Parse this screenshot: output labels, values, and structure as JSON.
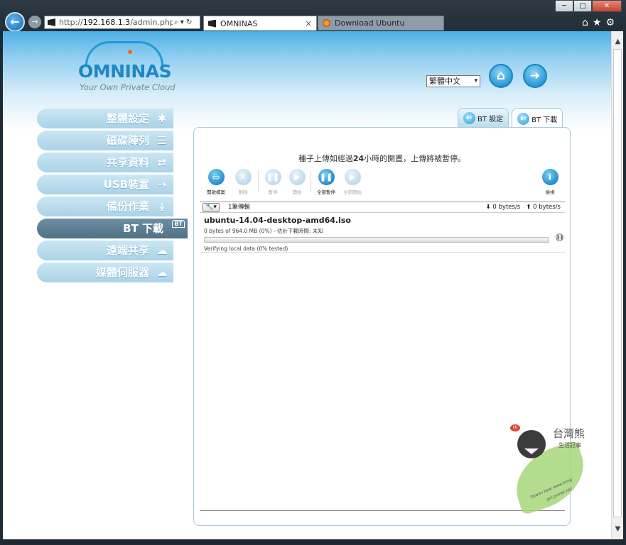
{
  "browser": {
    "window_controls": {
      "minimize": "─",
      "maximize": "□",
      "close": "✕"
    },
    "back_glyph": "←",
    "forward_glyph": "→",
    "address": {
      "prefix": "http://",
      "host": "192.168.1.3",
      "path": "/admin.php?mer",
      "tools": "⌕ ▾ ↻"
    },
    "tabs": [
      {
        "label": "OMNINAS",
        "close": "×"
      },
      {
        "label": "Download Ubuntu"
      }
    ],
    "right_icons": "⌂★⚙"
  },
  "header": {
    "brand": "OMNINAS",
    "tagline": "Your Own Private Cloud",
    "language": "繁體中文",
    "caret": "▾",
    "home_icon": "⌂",
    "logout_icon": "➜"
  },
  "sidebar": {
    "items": [
      {
        "label": "整體設定",
        "icon": "✱"
      },
      {
        "label": "磁碟陣列",
        "icon": "☰"
      },
      {
        "label": "共享資料",
        "icon": "⇄"
      },
      {
        "label": "USB裝置",
        "icon": "⇢"
      },
      {
        "label": "備份作業",
        "icon": "⤓"
      },
      {
        "label": "BT 下載",
        "icon": "BT"
      },
      {
        "label": "遠端共享",
        "icon": "☁"
      },
      {
        "label": "媒體伺服器",
        "icon": "☁"
      }
    ]
  },
  "panel_tabs": [
    {
      "label": "BT 設定",
      "badge": "BT"
    },
    {
      "label": "BT 下載",
      "badge": "BT"
    }
  ],
  "notice": {
    "before": "種子上傳如經過",
    "highlight": "24",
    "after": "小時的開置，上傳將被暫停。"
  },
  "toolbar": [
    {
      "label": "開啟檔案",
      "icon": "▭"
    },
    {
      "label": "刪除",
      "icon": "✕"
    },
    {
      "label": "暫停",
      "icon": "❚❚"
    },
    {
      "label": "開始",
      "icon": "▶"
    },
    {
      "label": "全部暫停",
      "icon": "❚❚"
    },
    {
      "label": "全部開始",
      "icon": "▶"
    },
    {
      "label": "檢視",
      "icon": "i"
    }
  ],
  "statusbar": {
    "wrench_icon": "🔧▾",
    "count": "1筆傳輸",
    "download_speed": "⬇ 0 bytes/s",
    "upload_speed": "⬆ 0 bytes/s"
  },
  "torrent": {
    "name": "ubuntu-14.04-desktop-amd64.iso",
    "info": "0 bytes of 964.0 MB (0%) - 估計下載時間: 未知",
    "progress_percent": 0,
    "pause_icon": "❚❚",
    "status": "Verifying local data (0% tested)"
  },
  "watermark": {
    "badge": "HI",
    "title": "台灣熊",
    "subtitle": "生活記事",
    "url_line1": "Taiwan bear www.hong",
    "url_line2": "girl.pixnet.net"
  }
}
